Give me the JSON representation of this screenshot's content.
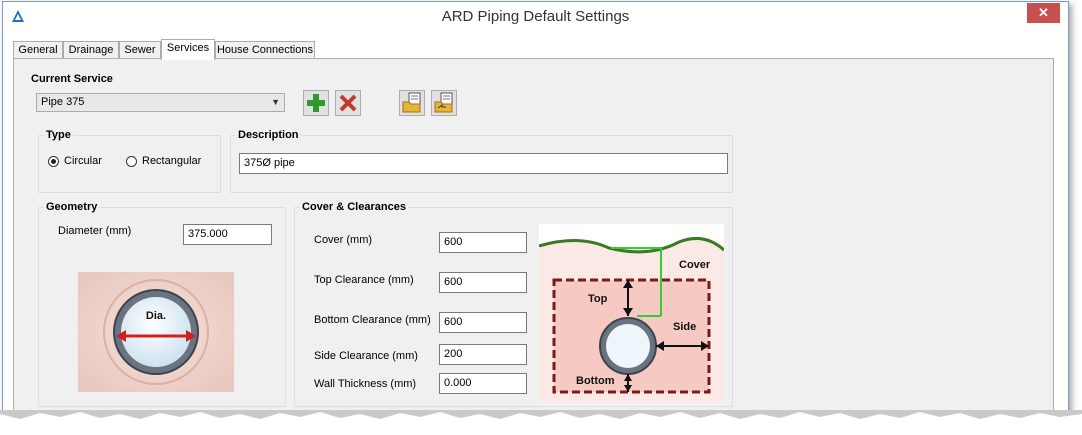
{
  "window": {
    "title": "ARD Piping Default Settings",
    "close_label": "✕"
  },
  "tabs": [
    "General",
    "Drainage",
    "Sewer",
    "Services",
    "House Connections"
  ],
  "active_tab": "Services",
  "current_service": {
    "label": "Current Service",
    "selected": "Pipe 375"
  },
  "type": {
    "label": "Type",
    "options": [
      "Circular",
      "Rectangular"
    ],
    "selected": "Circular"
  },
  "description": {
    "label": "Description",
    "value": "375Ø pipe"
  },
  "geometry": {
    "label": "Geometry",
    "diameter_label": "Diameter (mm)",
    "diameter_value": "375.000",
    "diagram_label": "Dia."
  },
  "cover": {
    "label": "Cover & Clearances",
    "fields": [
      {
        "label": "Cover (mm)",
        "value": "600"
      },
      {
        "label": "Top Clearance (mm)",
        "value": "600"
      },
      {
        "label": "Bottom Clearance (mm)",
        "value": "600"
      },
      {
        "label": "Side Clearance (mm)",
        "value": "200"
      },
      {
        "label": "Wall Thickness (mm)",
        "value": "0.000"
      }
    ],
    "diagram": {
      "cover": "Cover",
      "top": "Top",
      "side": "Side",
      "bottom": "Bottom"
    }
  },
  "colors": {
    "accent_green": "#2e9a2e",
    "delete_red": "#c0392b",
    "diagram_bg": "#f4d6cf"
  }
}
